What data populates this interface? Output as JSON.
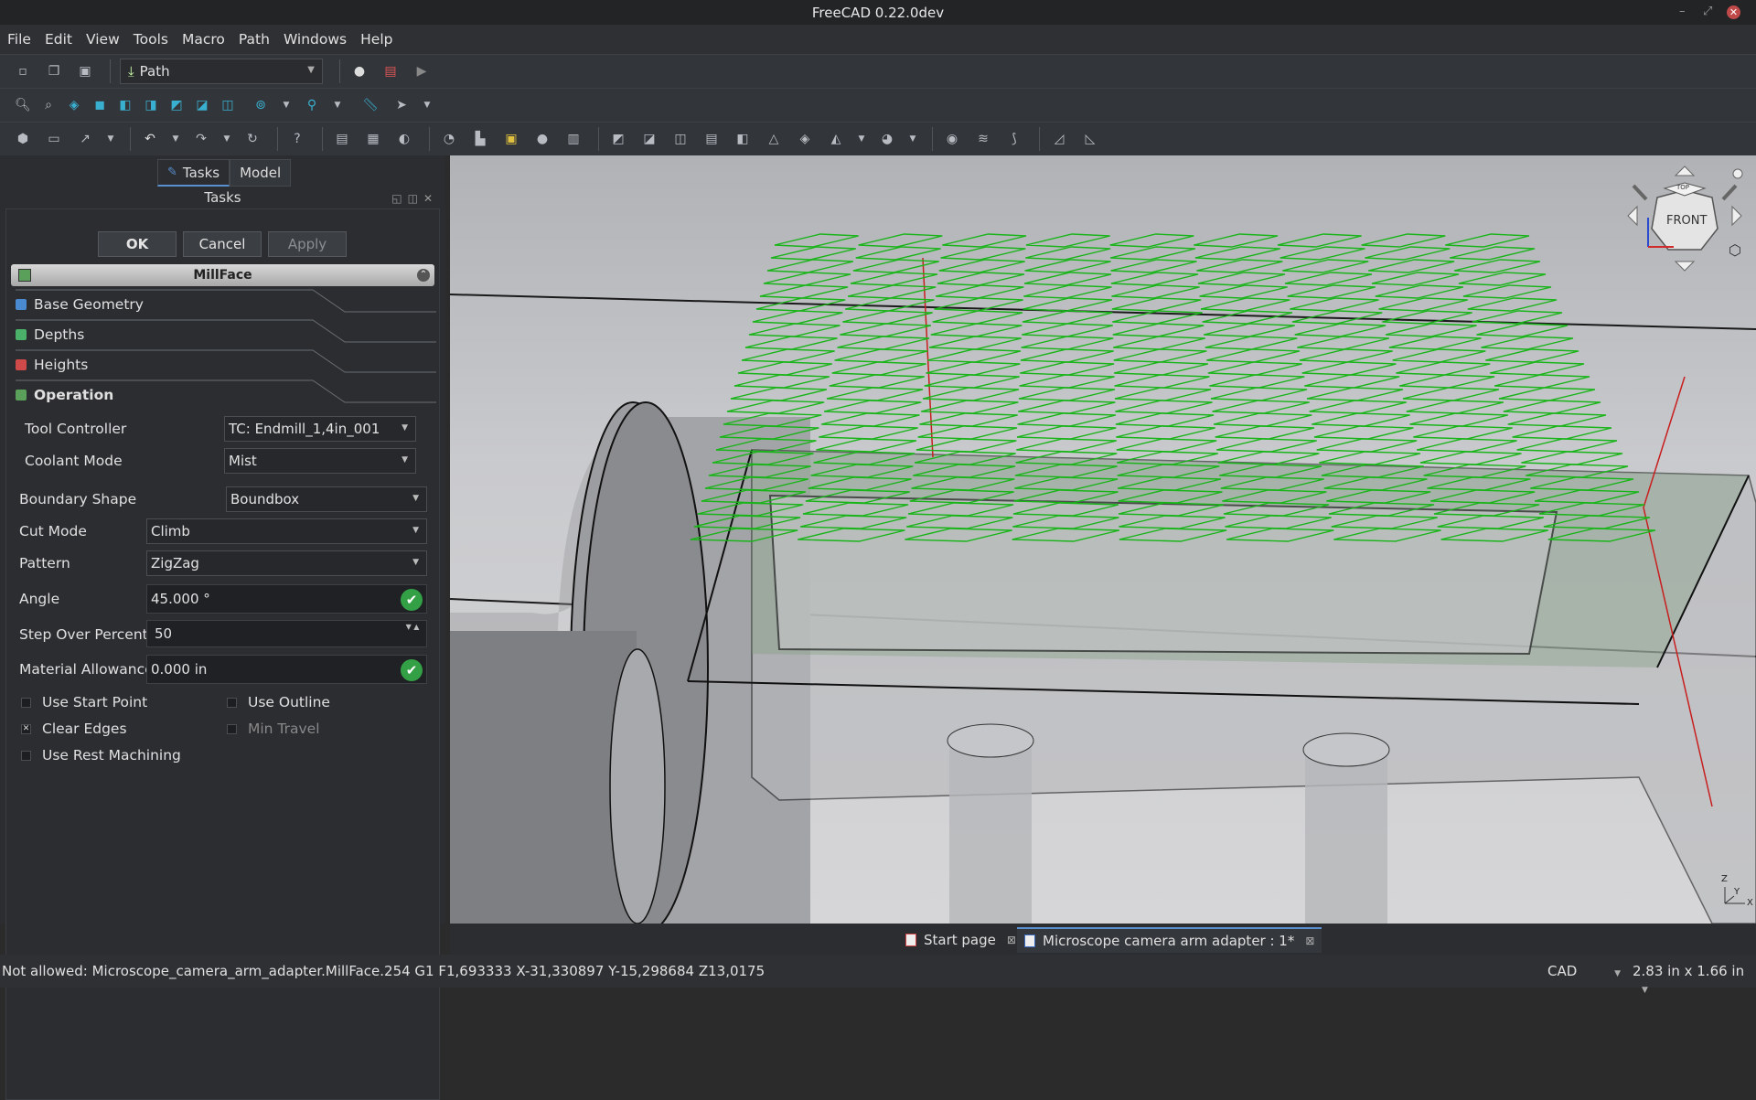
{
  "window": {
    "title": "FreeCAD 0.22.0dev"
  },
  "menubar": [
    "File",
    "Edit",
    "View",
    "Tools",
    "Macro",
    "Path",
    "Windows",
    "Help"
  ],
  "workbench": {
    "selected": "Path"
  },
  "combo_view": {
    "tabs": [
      "Tasks",
      "Model"
    ],
    "active_tab": "Tasks",
    "header": "Tasks"
  },
  "task_buttons": {
    "ok": "OK",
    "cancel": "Cancel",
    "apply": "Apply"
  },
  "operation_header": "MillFace",
  "sections": [
    "Base Geometry",
    "Depths",
    "Heights",
    "Operation"
  ],
  "operation": {
    "tool_controller": {
      "label": "Tool Controller",
      "value": "TC: Endmill_1,4in_001"
    },
    "coolant_mode": {
      "label": "Coolant Mode",
      "value": "Mist"
    },
    "boundary_shape": {
      "label": "Boundary Shape",
      "value": "Boundbox"
    },
    "cut_mode": {
      "label": "Cut Mode",
      "value": "Climb"
    },
    "pattern": {
      "label": "Pattern",
      "value": "ZigZag"
    },
    "angle": {
      "label": "Angle",
      "value": "45.000 °"
    },
    "step_over": {
      "label": "Step Over Percent",
      "value": "50"
    },
    "material_allowance": {
      "label": "Material Allowance",
      "value": "0.000 in"
    }
  },
  "checkboxes": {
    "use_start_point": {
      "label": "Use Start Point",
      "checked": false
    },
    "use_outline": {
      "label": "Use Outline",
      "checked": false
    },
    "clear_edges": {
      "label": "Clear Edges",
      "checked": true
    },
    "min_travel": {
      "label": "Min Travel",
      "checked": false,
      "disabled": true
    },
    "use_rest_machining": {
      "label": "Use Rest Machining",
      "checked": false
    }
  },
  "navcube": {
    "top_label": "TOP",
    "front_label": "FRONT"
  },
  "axis_labels": {
    "z": "Z",
    "y": "Y",
    "x": "X"
  },
  "doc_tabs": [
    {
      "label": "Start page",
      "active": false
    },
    {
      "label": "Microscope camera arm adapter : 1*",
      "active": true
    }
  ],
  "statusbar": {
    "message": "Not allowed: Microscope_camera_arm_adapter.MillFace.254 G1 F1,693333 X-31,330897 Y-15,298684 Z13,0175",
    "nav_style": "CAD",
    "dimensions": "2.83 in x 1.66 in"
  },
  "colors": {
    "toolpath": "#19b419",
    "accent": "#5a8fd0",
    "ok_check": "#34a046"
  }
}
